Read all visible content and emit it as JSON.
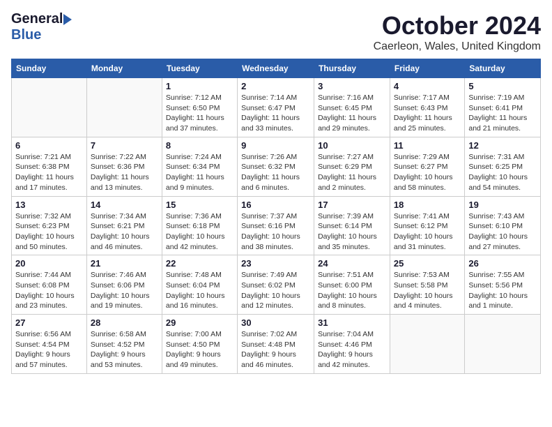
{
  "logo": {
    "line1": "General",
    "line2": "Blue"
  },
  "title": "October 2024",
  "location": "Caerleon, Wales, United Kingdom",
  "headers": [
    "Sunday",
    "Monday",
    "Tuesday",
    "Wednesday",
    "Thursday",
    "Friday",
    "Saturday"
  ],
  "weeks": [
    [
      {
        "day": "",
        "content": ""
      },
      {
        "day": "",
        "content": ""
      },
      {
        "day": "1",
        "content": "Sunrise: 7:12 AM\nSunset: 6:50 PM\nDaylight: 11 hours and 37 minutes."
      },
      {
        "day": "2",
        "content": "Sunrise: 7:14 AM\nSunset: 6:47 PM\nDaylight: 11 hours and 33 minutes."
      },
      {
        "day": "3",
        "content": "Sunrise: 7:16 AM\nSunset: 6:45 PM\nDaylight: 11 hours and 29 minutes."
      },
      {
        "day": "4",
        "content": "Sunrise: 7:17 AM\nSunset: 6:43 PM\nDaylight: 11 hours and 25 minutes."
      },
      {
        "day": "5",
        "content": "Sunrise: 7:19 AM\nSunset: 6:41 PM\nDaylight: 11 hours and 21 minutes."
      }
    ],
    [
      {
        "day": "6",
        "content": "Sunrise: 7:21 AM\nSunset: 6:38 PM\nDaylight: 11 hours and 17 minutes."
      },
      {
        "day": "7",
        "content": "Sunrise: 7:22 AM\nSunset: 6:36 PM\nDaylight: 11 hours and 13 minutes."
      },
      {
        "day": "8",
        "content": "Sunrise: 7:24 AM\nSunset: 6:34 PM\nDaylight: 11 hours and 9 minutes."
      },
      {
        "day": "9",
        "content": "Sunrise: 7:26 AM\nSunset: 6:32 PM\nDaylight: 11 hours and 6 minutes."
      },
      {
        "day": "10",
        "content": "Sunrise: 7:27 AM\nSunset: 6:29 PM\nDaylight: 11 hours and 2 minutes."
      },
      {
        "day": "11",
        "content": "Sunrise: 7:29 AM\nSunset: 6:27 PM\nDaylight: 10 hours and 58 minutes."
      },
      {
        "day": "12",
        "content": "Sunrise: 7:31 AM\nSunset: 6:25 PM\nDaylight: 10 hours and 54 minutes."
      }
    ],
    [
      {
        "day": "13",
        "content": "Sunrise: 7:32 AM\nSunset: 6:23 PM\nDaylight: 10 hours and 50 minutes."
      },
      {
        "day": "14",
        "content": "Sunrise: 7:34 AM\nSunset: 6:21 PM\nDaylight: 10 hours and 46 minutes."
      },
      {
        "day": "15",
        "content": "Sunrise: 7:36 AM\nSunset: 6:18 PM\nDaylight: 10 hours and 42 minutes."
      },
      {
        "day": "16",
        "content": "Sunrise: 7:37 AM\nSunset: 6:16 PM\nDaylight: 10 hours and 38 minutes."
      },
      {
        "day": "17",
        "content": "Sunrise: 7:39 AM\nSunset: 6:14 PM\nDaylight: 10 hours and 35 minutes."
      },
      {
        "day": "18",
        "content": "Sunrise: 7:41 AM\nSunset: 6:12 PM\nDaylight: 10 hours and 31 minutes."
      },
      {
        "day": "19",
        "content": "Sunrise: 7:43 AM\nSunset: 6:10 PM\nDaylight: 10 hours and 27 minutes."
      }
    ],
    [
      {
        "day": "20",
        "content": "Sunrise: 7:44 AM\nSunset: 6:08 PM\nDaylight: 10 hours and 23 minutes."
      },
      {
        "day": "21",
        "content": "Sunrise: 7:46 AM\nSunset: 6:06 PM\nDaylight: 10 hours and 19 minutes."
      },
      {
        "day": "22",
        "content": "Sunrise: 7:48 AM\nSunset: 6:04 PM\nDaylight: 10 hours and 16 minutes."
      },
      {
        "day": "23",
        "content": "Sunrise: 7:49 AM\nSunset: 6:02 PM\nDaylight: 10 hours and 12 minutes."
      },
      {
        "day": "24",
        "content": "Sunrise: 7:51 AM\nSunset: 6:00 PM\nDaylight: 10 hours and 8 minutes."
      },
      {
        "day": "25",
        "content": "Sunrise: 7:53 AM\nSunset: 5:58 PM\nDaylight: 10 hours and 4 minutes."
      },
      {
        "day": "26",
        "content": "Sunrise: 7:55 AM\nSunset: 5:56 PM\nDaylight: 10 hours and 1 minute."
      }
    ],
    [
      {
        "day": "27",
        "content": "Sunrise: 6:56 AM\nSunset: 4:54 PM\nDaylight: 9 hours and 57 minutes."
      },
      {
        "day": "28",
        "content": "Sunrise: 6:58 AM\nSunset: 4:52 PM\nDaylight: 9 hours and 53 minutes."
      },
      {
        "day": "29",
        "content": "Sunrise: 7:00 AM\nSunset: 4:50 PM\nDaylight: 9 hours and 49 minutes."
      },
      {
        "day": "30",
        "content": "Sunrise: 7:02 AM\nSunset: 4:48 PM\nDaylight: 9 hours and 46 minutes."
      },
      {
        "day": "31",
        "content": "Sunrise: 7:04 AM\nSunset: 4:46 PM\nDaylight: 9 hours and 42 minutes."
      },
      {
        "day": "",
        "content": ""
      },
      {
        "day": "",
        "content": ""
      }
    ]
  ]
}
